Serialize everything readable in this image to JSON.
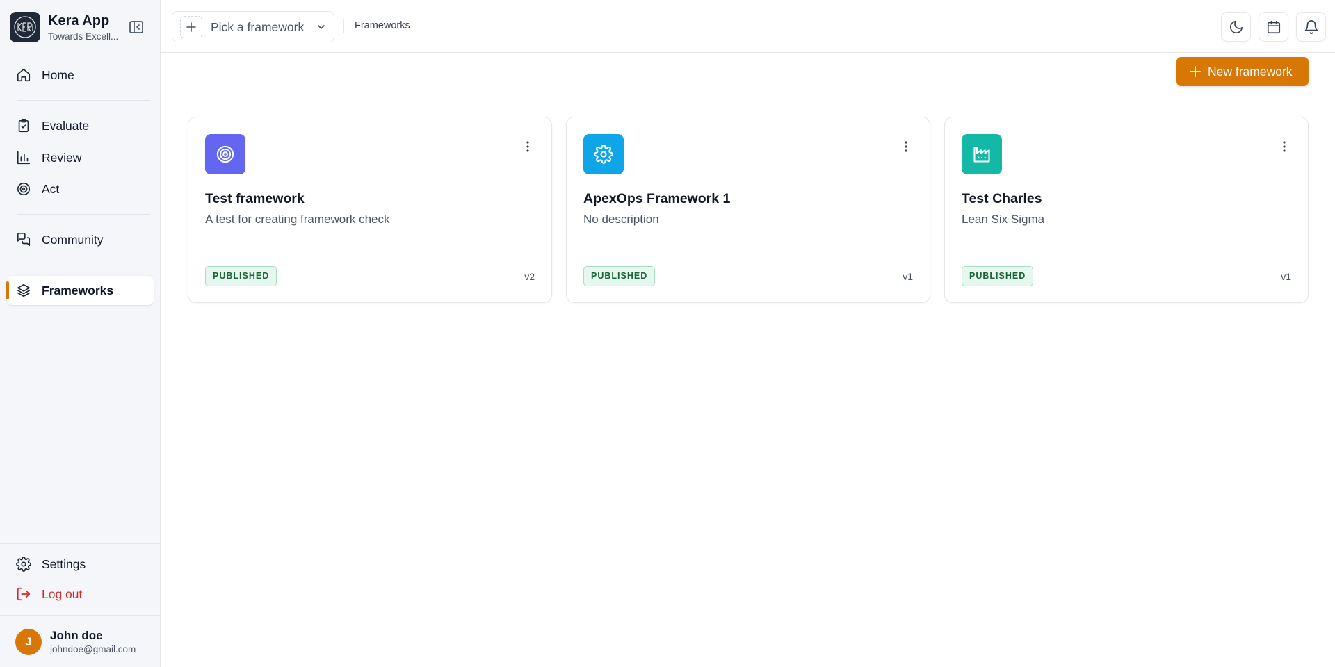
{
  "app": {
    "title": "Kera App",
    "subtitle": "Towards Excell...",
    "logo_icon": "kera-logo"
  },
  "sidebar": {
    "items": [
      {
        "label": "Home",
        "icon": "home-icon"
      },
      {
        "label": "Evaluate",
        "icon": "clipboard-check-icon"
      },
      {
        "label": "Review",
        "icon": "bar-chart-icon"
      },
      {
        "label": "Act",
        "icon": "target-icon"
      },
      {
        "label": "Community",
        "icon": "chat-icon"
      },
      {
        "label": "Frameworks",
        "icon": "layers-icon",
        "active": true
      }
    ],
    "settings_label": "Settings",
    "logout_label": "Log out"
  },
  "user": {
    "initial": "J",
    "name": "John doe",
    "email": "johndoe@gmail.com"
  },
  "topbar": {
    "picker_placeholder": "Pick a framework",
    "breadcrumb": "Frameworks",
    "actions": [
      "moon-icon",
      "calendar-icon",
      "bell-icon"
    ]
  },
  "main": {
    "new_button_label": "New framework",
    "cards": [
      {
        "title": "Test framework",
        "description": "A test for creating framework check",
        "status": "PUBLISHED",
        "version": "v2",
        "icon": "target-icon",
        "icon_color": "#6366f1"
      },
      {
        "title": "ApexOps Framework 1",
        "description": "No description",
        "status": "PUBLISHED",
        "version": "v1",
        "icon": "gear-icon",
        "icon_color": "#0ea5e9"
      },
      {
        "title": "Test Charles",
        "description": "Lean Six Sigma",
        "status": "PUBLISHED",
        "version": "v1",
        "icon": "factory-icon",
        "icon_color": "#14b8a6"
      }
    ]
  },
  "colors": {
    "accent": "#d97706",
    "danger": "#dc2626",
    "published_bg": "#e6f7ef",
    "published_text": "#166534"
  }
}
